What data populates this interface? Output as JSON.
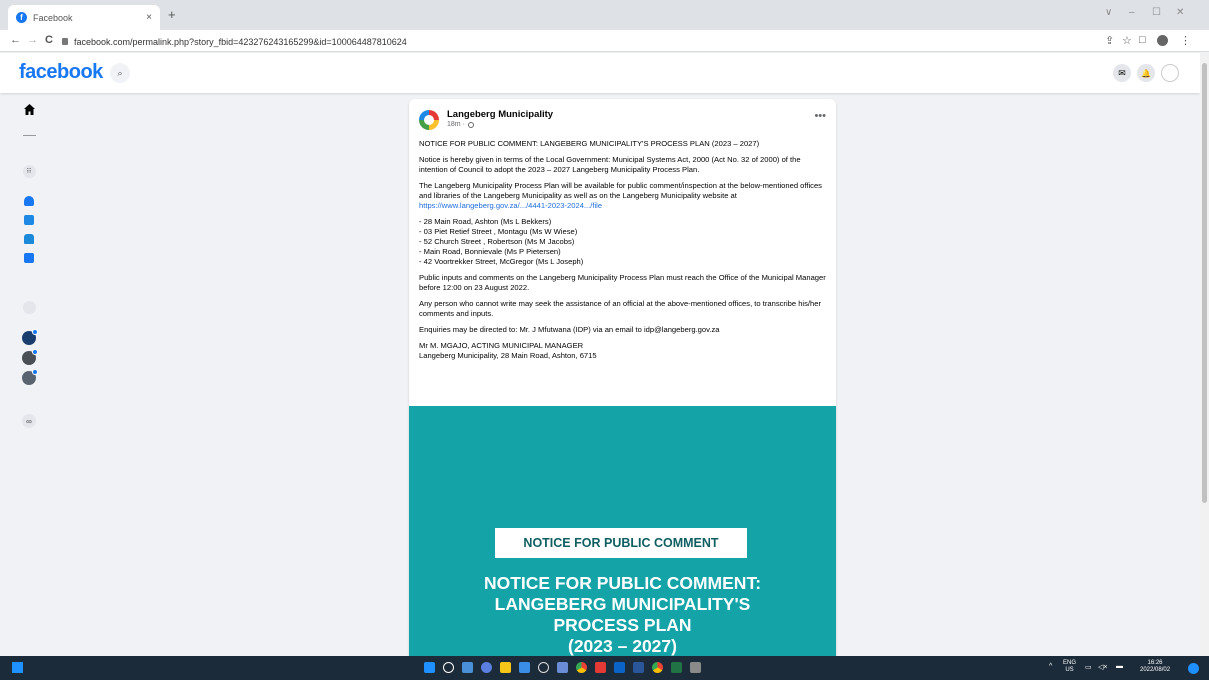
{
  "browser": {
    "tab_title": "Facebook",
    "tab_close": "×",
    "new_tab": "+",
    "url": "facebook.com/permalink.php?story_fbid=423276243165299&id=100064487810624",
    "back": "←",
    "forward": "→",
    "reload": "C",
    "share_icon": "⇪",
    "star_icon": "☆",
    "sidepanel_icon": "□",
    "menu_icon": "⋮",
    "minimize": "–",
    "restore": "☐",
    "close": "✕",
    "dropdown": "∨"
  },
  "facebook": {
    "logo": "facebook",
    "search_icon": "⌕",
    "messenger_icon": "✉",
    "notifications_icon": "🔔"
  },
  "post": {
    "page_name": "Langeberg Municipality",
    "time": "18m",
    "more": "•••",
    "title_line": "NOTICE FOR PUBLIC COMMENT: LANGEBERG MUNICIPALITY'S PROCESS PLAN (2023 – 2027)",
    "p1": "Notice is hereby given in terms of the Local Government: Municipal Systems Act, 2000 (Act No. 32 of 2000) of the intention of Council to adopt the 2023 – 2027 Langeberg Municipality Process Plan.",
    "p2_text": "The Langeberg Municipality Process Plan will be available for public comment/inspection at the below-mentioned offices and libraries of the Langeberg Municipality as well as on the Langeberg Municipality website at ",
    "p2_link": "https://www.langeberg.gov.za/.../4441-2023-2024.../file",
    "offices": [
      "- 28 Main Road, Ashton (Ms L Bekkers)",
      "- 03 Piet Retief Street , Montagu (Ms W Wiese)",
      "- 52 Church Street , Robertson (Ms M Jacobs)",
      "- Main Road, Bonnievale (Ms P Pietersen)",
      "- 42 Voortrekker Street, McGregor (Ms L Joseph)"
    ],
    "p3": "Public inputs and comments on the Langeberg Municipality Process Plan must reach the Office of the Municipal Manager before 12:00 on 23 August 2022.",
    "p4": "Any person who cannot write may seek the assistance of an official at the above-mentioned offices, to transcribe his/her comments and inputs.",
    "p5": "Enquiries may be directed to: Mr. J Mfutwana (IDP) via an email to idp@langeberg.gov.za",
    "sign1": "Mr M. MGAJO, ACTING MUNICIPAL MANAGER",
    "sign2": "Langeberg Municipality, 28 Main Road, Ashton, 6715",
    "image_box": "NOTICE FOR PUBLIC COMMENT",
    "image_headline": [
      "NOTICE FOR PUBLIC COMMENT:",
      "LANGEBERG MUNICIPALITY'S",
      "PROCESS PLAN",
      "(2023 – 2027)"
    ]
  },
  "taskbar": {
    "chevron": "^",
    "lang_top": "ENG",
    "lang_bottom": "US",
    "time": "16:26",
    "date": "2022/08/02"
  },
  "colors": {
    "facebook_blue": "#1877f2",
    "teal": "#14a4a8",
    "taskbar": "#1c2b3a"
  }
}
